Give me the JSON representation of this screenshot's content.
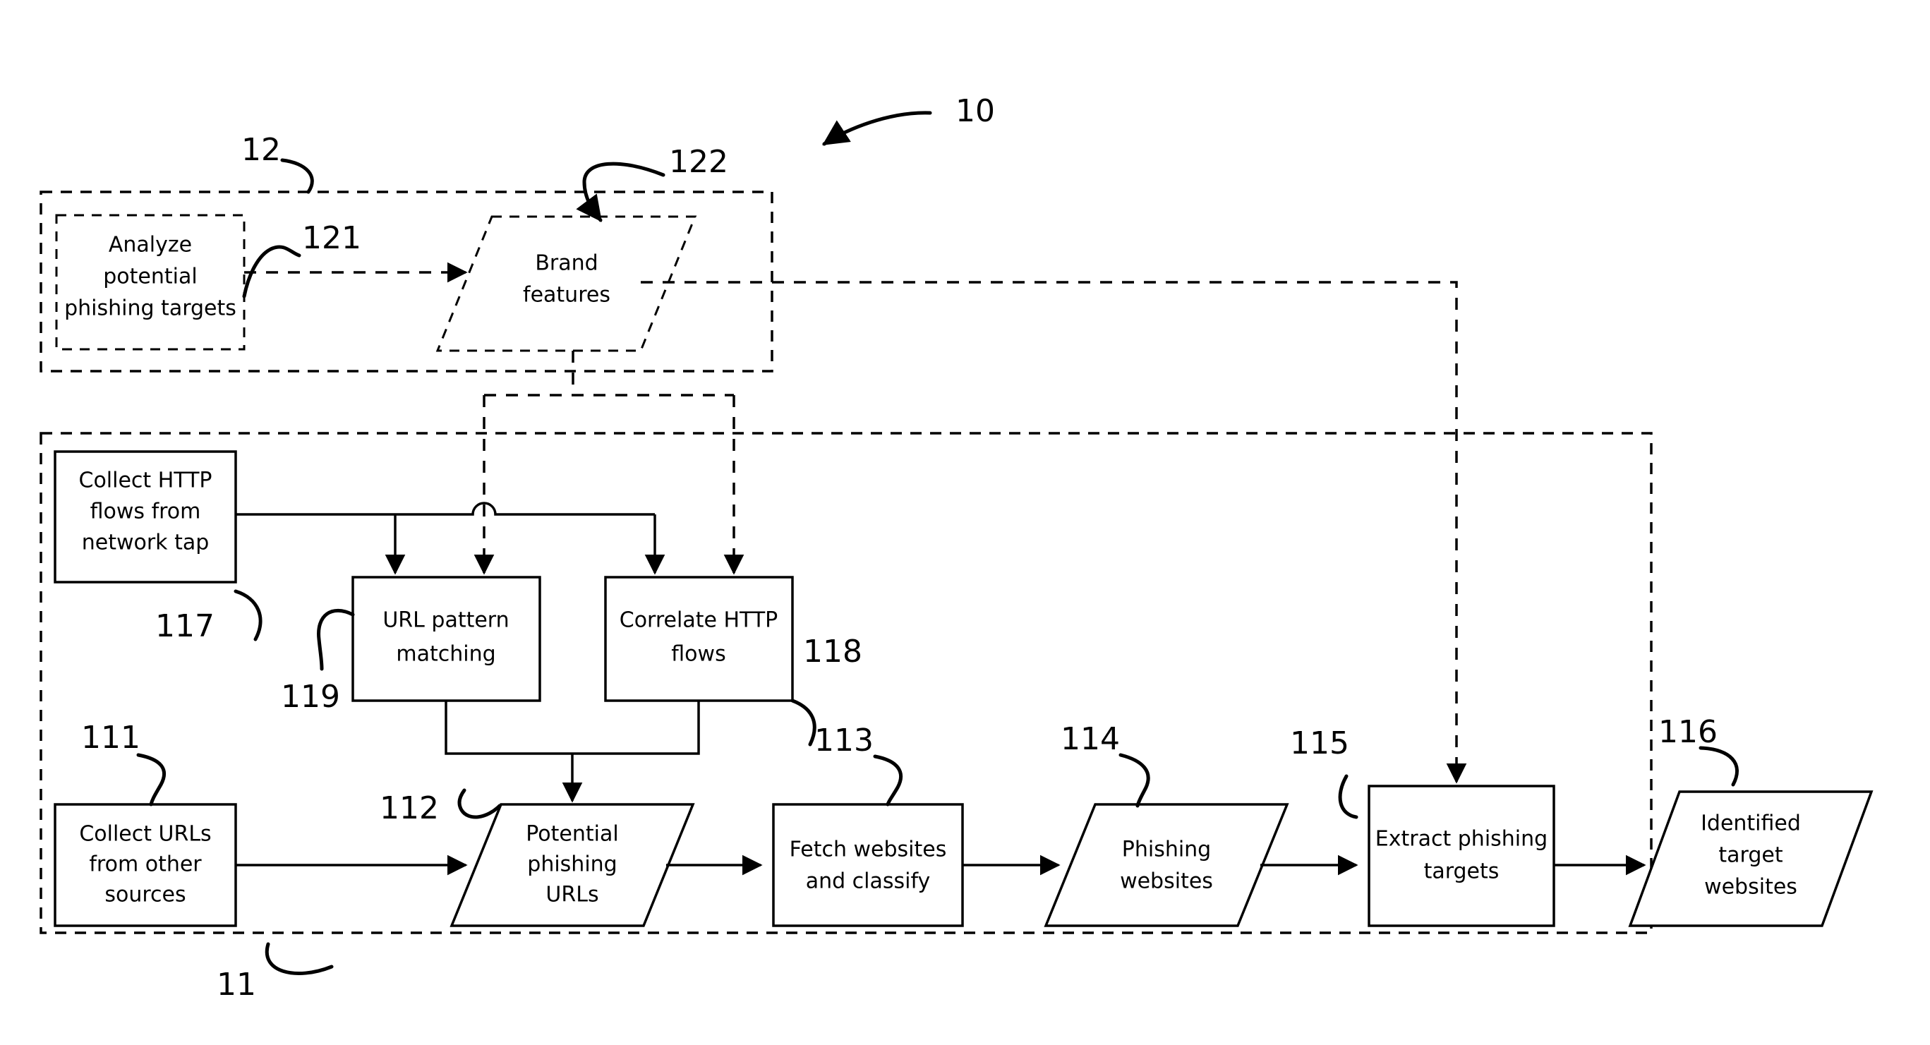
{
  "figure": {
    "title_ref": "10",
    "background": "#ffffff",
    "stroke_color": "#000000"
  },
  "containers": [
    {
      "id": "module-12",
      "ref": "12",
      "style": "dashed",
      "name": "brand-analysis-module"
    },
    {
      "id": "module-11",
      "ref": "11",
      "style": "dashed",
      "name": "phishing-detection-module"
    }
  ],
  "nodes": [
    {
      "id": "n121",
      "ref": "121",
      "shape": "rect-dashed",
      "lines": [
        "Analyze",
        "potential",
        "phishing targets"
      ],
      "text": "Analyze potential phishing targets"
    },
    {
      "id": "n122",
      "ref": "122",
      "shape": "parallelogram-dashed",
      "lines": [
        "Brand",
        "features"
      ],
      "text": "Brand features"
    },
    {
      "id": "n117",
      "ref": "117",
      "shape": "rect",
      "lines": [
        "Collect HTTP",
        "flows from",
        "network tap"
      ],
      "text": "Collect HTTP flows from network tap"
    },
    {
      "id": "n119",
      "ref": "119",
      "shape": "rect",
      "lines": [
        "URL pattern",
        "matching"
      ],
      "text": "URL pattern matching"
    },
    {
      "id": "n118",
      "ref": "118",
      "shape": "rect",
      "lines": [
        "Correlate HTTP",
        "flows"
      ],
      "text": "Correlate HTTP flows"
    },
    {
      "id": "n111",
      "ref": "111",
      "shape": "rect",
      "lines": [
        "Collect URLs",
        "from other",
        "sources"
      ],
      "text": "Collect URLs from other sources"
    },
    {
      "id": "n112",
      "ref": "112",
      "shape": "parallelogram",
      "lines": [
        "Potential",
        "phishing",
        "URLs"
      ],
      "text": "Potential phishing URLs"
    },
    {
      "id": "n113",
      "ref": "113",
      "shape": "rect",
      "lines": [
        "Fetch websites",
        "and classify"
      ],
      "text": "Fetch websites and classify"
    },
    {
      "id": "n114",
      "ref": "114",
      "shape": "parallelogram",
      "lines": [
        "Phishing",
        "websites"
      ],
      "text": "Phishing websites"
    },
    {
      "id": "n115",
      "ref": "115",
      "shape": "rect",
      "lines": [
        "Extract phishing",
        "targets"
      ],
      "text": "Extract phishing targets"
    },
    {
      "id": "n116",
      "ref": "116",
      "shape": "parallelogram",
      "lines": [
        "Identified",
        "target",
        "websites"
      ],
      "text": "Identified target websites"
    }
  ],
  "labels": {
    "ref_10": "10",
    "ref_11": "11",
    "ref_12": "12",
    "ref_111": "111",
    "ref_112": "112",
    "ref_113": "113",
    "ref_114": "114",
    "ref_115": "115",
    "ref_116": "116",
    "ref_117": "117",
    "ref_118": "118",
    "ref_119": "119",
    "ref_121": "121",
    "ref_122": "122",
    "n121_l1": "Analyze",
    "n121_l2": "potential",
    "n121_l3": "phishing targets",
    "n122_l1": "Brand",
    "n122_l2": "features",
    "n117_l1": "Collect HTTP",
    "n117_l2": "flows from",
    "n117_l3": "network tap",
    "n119_l1": "URL pattern",
    "n119_l2": "matching",
    "n118_l1": "Correlate HTTP",
    "n118_l2": "flows",
    "n111_l1": "Collect URLs",
    "n111_l2": "from other",
    "n111_l3": "sources",
    "n112_l1": "Potential",
    "n112_l2": "phishing",
    "n112_l3": "URLs",
    "n113_l1": "Fetch websites",
    "n113_l2": "and classify",
    "n114_l1": "Phishing",
    "n114_l2": "websites",
    "n115_l1": "Extract phishing",
    "n115_l2": "targets",
    "n116_l1": "Identified",
    "n116_l2": "target",
    "n116_l3": "websites"
  },
  "flow": {
    "type": "flowchart",
    "edges": [
      {
        "from": "n121",
        "to": "n122",
        "style": "dashed"
      },
      {
        "from": "n122",
        "to": "n119",
        "style": "dashed"
      },
      {
        "from": "n122",
        "to": "n118",
        "style": "dashed"
      },
      {
        "from": "n122",
        "to": "n115",
        "style": "dashed"
      },
      {
        "from": "n117",
        "to": "n119",
        "style": "solid"
      },
      {
        "from": "n117",
        "to": "n118",
        "style": "solid"
      },
      {
        "from": "n119",
        "to": "n112",
        "style": "solid"
      },
      {
        "from": "n118",
        "to": "n112",
        "style": "solid"
      },
      {
        "from": "n111",
        "to": "n112",
        "style": "solid"
      },
      {
        "from": "n112",
        "to": "n113",
        "style": "solid"
      },
      {
        "from": "n113",
        "to": "n114",
        "style": "solid"
      },
      {
        "from": "n114",
        "to": "n115",
        "style": "solid"
      },
      {
        "from": "n115",
        "to": "n116",
        "style": "solid"
      }
    ]
  }
}
